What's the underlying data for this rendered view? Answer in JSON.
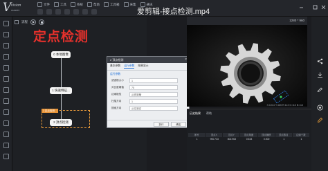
{
  "app": {
    "logo_mark": "V",
    "logo_line1": "vision",
    "logo_line2": "master",
    "video_title": "爱剪辑-接点检测.mp4"
  },
  "menu": {
    "items": [
      {
        "label": "文件",
        "icon": "file-icon"
      },
      {
        "label": "工具",
        "icon": "tool-icon"
      },
      {
        "label": "系统",
        "icon": "system-icon"
      },
      {
        "label": "帮助",
        "icon": "help-icon"
      },
      {
        "label": "工具箱",
        "icon": "toolbox-icon"
      },
      {
        "label": "采集",
        "icon": "camera-icon"
      },
      {
        "label": "通讯",
        "icon": "comm-icon"
      }
    ]
  },
  "canvas": {
    "header_label": "流程",
    "big_title": "定点检测",
    "group_tag": "1 定点检测",
    "nodes": [
      {
        "label": "0 本地图像"
      },
      {
        "label": "1 快速特征..."
      },
      {
        "label": "2 顶点检测"
      }
    ]
  },
  "dialog": {
    "title": "2 顶点检测",
    "close": "×",
    "tabs": [
      "基本参数",
      "运行参数",
      "结果显示"
    ],
    "section": "运行参数",
    "rows": [
      {
        "key": "滤波核大小",
        "value": "1"
      },
      {
        "key": "对比度阈值",
        "value": "75"
      },
      {
        "key": "边缘极性",
        "value": "从亮到暗"
      },
      {
        "key": "扫描方向",
        "value": "1"
      },
      {
        "key": "搜索方向",
        "value": "从左到右"
      }
    ],
    "buttons": [
      "执行",
      "确定"
    ]
  },
  "viewer": {
    "resolution": "1280 * 960",
    "status": "X:1014  Y:465  R:113  G:113  B:113"
  },
  "results": {
    "tabs": [
      "历史结果",
      "帮助"
    ],
    "columns": [
      "序号",
      "顶点X",
      "顶点Y",
      "顶点角度",
      "顶点偏移",
      "顶点数目",
      "边缘个数"
    ],
    "rows": [
      [
        "1",
        "900.733",
        "802.963",
        "0.533",
        "0.000",
        "1",
        "1"
      ]
    ]
  },
  "right_rail": {
    "icons": [
      "share-icon",
      "download-icon",
      "brush-icon",
      "record-icon",
      "pen-icon"
    ]
  }
}
